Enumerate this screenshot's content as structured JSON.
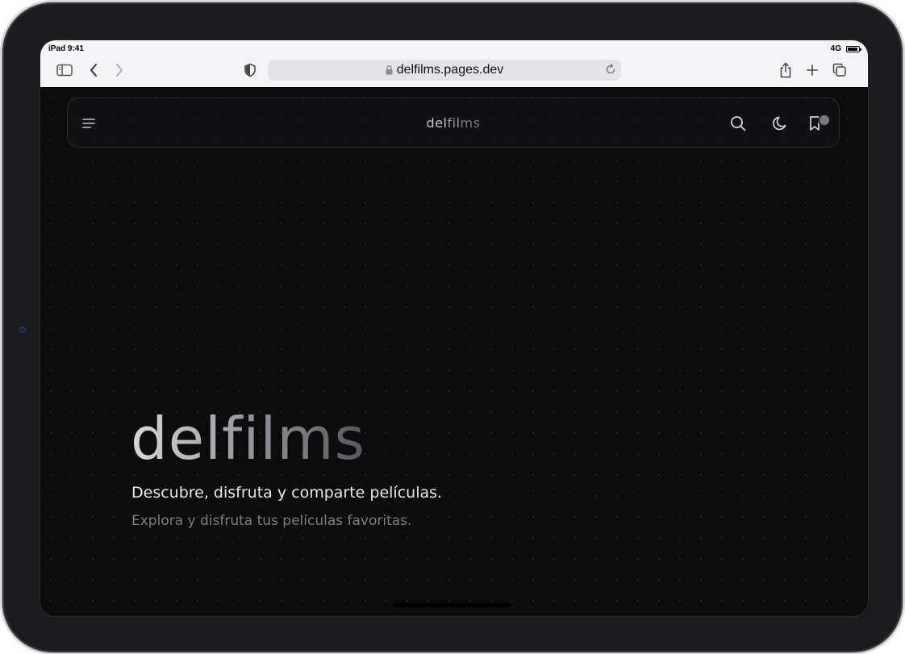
{
  "status_bar": {
    "device_time": "iPad 9:41",
    "network": "4G"
  },
  "browser": {
    "url": "delfilms.pages.dev",
    "icons": [
      "sidebar-icon",
      "back-icon",
      "forward-icon",
      "privacy-shield-icon",
      "lock-icon",
      "reload-icon",
      "share-icon",
      "new-tab-icon",
      "tabs-icon"
    ]
  },
  "navbar": {
    "brand_part1": "del",
    "brand_part2": "fil",
    "brand_part3": "ms",
    "icons": [
      "menu-icon",
      "search-icon",
      "moon-icon",
      "bookmark-icon"
    ]
  },
  "hero": {
    "title": "delfilms",
    "subtitle": "Descubre, disfruta y comparte películas.",
    "description": "Explora y disfruta tus películas favoritas."
  },
  "colors": {
    "page_background": "#0c0c0d",
    "browser_chrome": "#f4f4f6",
    "url_bar": "#e4e4e8",
    "hero_subtitle": "#e8e8ea",
    "hero_description": "#7e7e84"
  }
}
